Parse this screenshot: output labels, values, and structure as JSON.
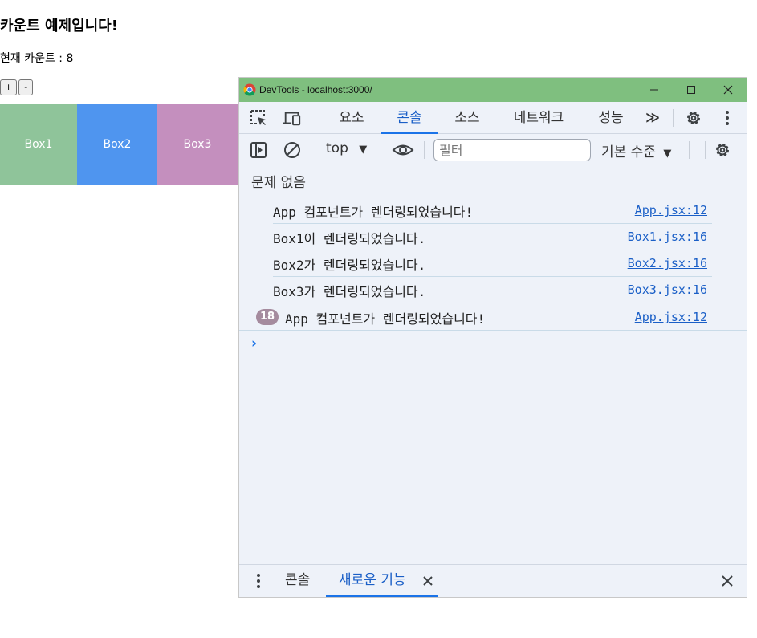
{
  "page": {
    "title": "카운트 예제입니다!",
    "count_line": "현재 카운트 : 8",
    "plus_label": "+",
    "minus_label": "-",
    "boxes": [
      {
        "label": "Box1",
        "color": "#8fc49a"
      },
      {
        "label": "Box2",
        "color": "#4f95ef"
      },
      {
        "label": "Box3",
        "color": "#c48fbe"
      }
    ]
  },
  "devtools": {
    "window_title": "DevTools - localhost:3000/",
    "titlebar_color": "#7fbf7f",
    "tabs": [
      {
        "label": "요소",
        "active": false
      },
      {
        "label": "콘솔",
        "active": true
      },
      {
        "label": "소스",
        "active": false
      },
      {
        "label": "네트워크",
        "active": false
      },
      {
        "label": "성능",
        "active": false
      }
    ],
    "more_tabs": "≫",
    "toolbar": {
      "context": "top",
      "filter_placeholder": "필터",
      "level": "기본 수준"
    },
    "issues": "문제 없음",
    "logs": [
      {
        "message": "App 컴포넌트가 렌더링되었습니다!",
        "source": "App.jsx:12"
      },
      {
        "message": "Box1이 렌더링되었습니다.",
        "source": "Box1.jsx:16"
      },
      {
        "message": "Box2가 렌더링되었습니다.",
        "source": "Box2.jsx:16"
      },
      {
        "message": "Box3가 렌더링되었습니다.",
        "source": "Box3.jsx:16"
      },
      {
        "count": "18",
        "message": "App 컴포넌트가 렌더링되었습니다!",
        "source": "App.jsx:12"
      }
    ],
    "prompt": "›",
    "drawer": {
      "tabs": [
        {
          "label": "콘솔",
          "active": false
        },
        {
          "label": "새로운 기능",
          "active": true
        }
      ]
    },
    "accent_color": "#1a73e8",
    "panel_bg": "#eef2f9"
  }
}
